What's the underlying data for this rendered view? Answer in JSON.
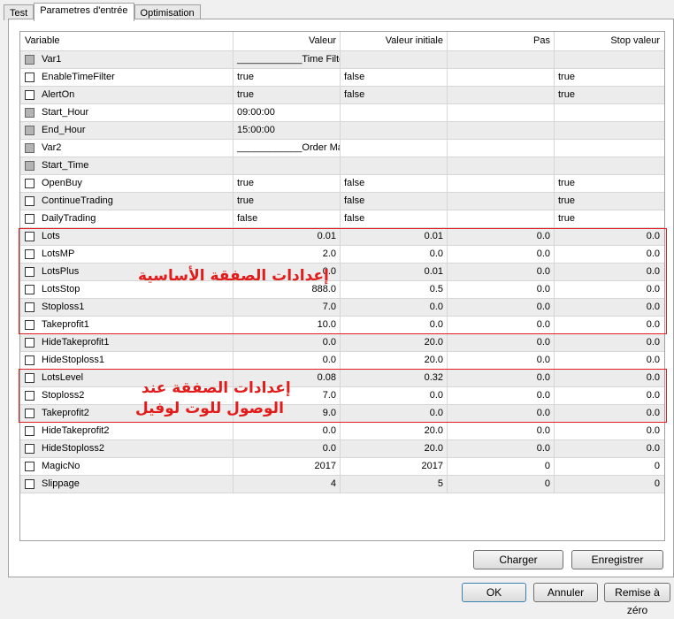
{
  "tabs": [
    "Test",
    "Parametres d'entrée",
    "Optimisation"
  ],
  "active_tab": 1,
  "columns": [
    "Variable",
    "Valeur",
    "Valeur initiale",
    "Pas",
    "Stop valeur"
  ],
  "rows": [
    {
      "name": "Var1",
      "disabled": true,
      "v": [
        "____________Time Filter",
        "",
        "",
        ""
      ],
      "num": false
    },
    {
      "name": "EnableTimeFilter",
      "disabled": false,
      "v": [
        "true",
        "false",
        "",
        "true"
      ],
      "num": false
    },
    {
      "name": "AlertOn",
      "disabled": false,
      "v": [
        "true",
        "false",
        "",
        "true"
      ],
      "num": false
    },
    {
      "name": "Start_Hour",
      "disabled": true,
      "v": [
        "09:00:00",
        "",
        "",
        ""
      ],
      "num": false
    },
    {
      "name": "End_Hour",
      "disabled": true,
      "v": [
        "15:00:00",
        "",
        "",
        ""
      ],
      "num": false
    },
    {
      "name": "Var2",
      "disabled": true,
      "v": [
        "____________Order Management",
        "",
        "",
        ""
      ],
      "num": false
    },
    {
      "name": "Start_Time",
      "disabled": true,
      "v": [
        "",
        "",
        "",
        ""
      ],
      "num": false
    },
    {
      "name": "OpenBuy",
      "disabled": false,
      "v": [
        "true",
        "false",
        "",
        "true"
      ],
      "num": false
    },
    {
      "name": "ContinueTrading",
      "disabled": false,
      "v": [
        "true",
        "false",
        "",
        "true"
      ],
      "num": false
    },
    {
      "name": "DailyTrading",
      "disabled": false,
      "v": [
        "false",
        "false",
        "",
        "true"
      ],
      "num": false
    },
    {
      "name": "Lots",
      "disabled": false,
      "v": [
        "0.01",
        "0.01",
        "0.0",
        "0.0"
      ],
      "num": true
    },
    {
      "name": "LotsMP",
      "disabled": false,
      "v": [
        "2.0",
        "0.0",
        "0.0",
        "0.0"
      ],
      "num": true
    },
    {
      "name": "LotsPlus",
      "disabled": false,
      "v": [
        "0.0",
        "0.01",
        "0.0",
        "0.0"
      ],
      "num": true
    },
    {
      "name": "LotsStop",
      "disabled": false,
      "v": [
        "888.0",
        "0.5",
        "0.0",
        "0.0"
      ],
      "num": true
    },
    {
      "name": "Stoploss1",
      "disabled": false,
      "v": [
        "7.0",
        "0.0",
        "0.0",
        "0.0"
      ],
      "num": true
    },
    {
      "name": "Takeprofit1",
      "disabled": false,
      "v": [
        "10.0",
        "0.0",
        "0.0",
        "0.0"
      ],
      "num": true
    },
    {
      "name": "HideTakeprofit1",
      "disabled": false,
      "v": [
        "0.0",
        "20.0",
        "0.0",
        "0.0"
      ],
      "num": true
    },
    {
      "name": "HideStoploss1",
      "disabled": false,
      "v": [
        "0.0",
        "20.0",
        "0.0",
        "0.0"
      ],
      "num": true
    },
    {
      "name": "LotsLevel",
      "disabled": false,
      "v": [
        "0.08",
        "0.32",
        "0.0",
        "0.0"
      ],
      "num": true
    },
    {
      "name": "Stoploss2",
      "disabled": false,
      "v": [
        "7.0",
        "0.0",
        "0.0",
        "0.0"
      ],
      "num": true
    },
    {
      "name": "Takeprofit2",
      "disabled": false,
      "v": [
        "9.0",
        "0.0",
        "0.0",
        "0.0"
      ],
      "num": true
    },
    {
      "name": "HideTakeprofit2",
      "disabled": false,
      "v": [
        "0.0",
        "20.0",
        "0.0",
        "0.0"
      ],
      "num": true
    },
    {
      "name": "HideStoploss2",
      "disabled": false,
      "v": [
        "0.0",
        "20.0",
        "0.0",
        "0.0"
      ],
      "num": true
    },
    {
      "name": "MagicNo",
      "disabled": false,
      "v": [
        "2017",
        "2017",
        "0",
        "0"
      ],
      "num": true
    },
    {
      "name": "Slippage",
      "disabled": false,
      "v": [
        "4",
        "5",
        "0",
        "0"
      ],
      "num": true
    }
  ],
  "annotations": {
    "note1": "إعدادات الصفقة الأساسية",
    "note2_line1": "إعدادات الصفقة عند",
    "note2_line2": "الوصول للوت لوفيل",
    "color": "#e21b1b"
  },
  "buttons": {
    "load": "Charger",
    "save": "Enregistrer",
    "ok": "OK",
    "cancel": "Annuler",
    "reset": "Remise à zéro"
  }
}
